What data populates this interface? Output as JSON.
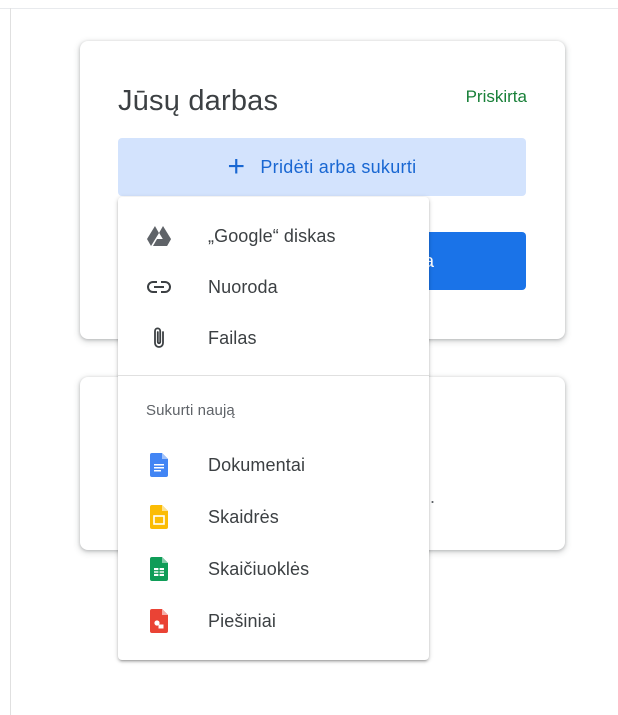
{
  "work_card": {
    "title": "Jūsų darbas",
    "status": "Priskirta",
    "add_button_icon": "+",
    "add_button_label": "Pridėti arba sukurti",
    "submit_button_fragment": "a",
    "submit_button_color": "#1a73e8"
  },
  "second_card": {
    "visible_fragment": "."
  },
  "menu": {
    "items": [
      {
        "label": "„Google“ diskas",
        "icon": "google-drive-icon"
      },
      {
        "label": "Nuoroda",
        "icon": "link-icon"
      },
      {
        "label": "Failas",
        "icon": "attachment-icon"
      }
    ],
    "create_section_label": "Sukurti naują",
    "create_items": [
      {
        "label": "Dokumentai",
        "icon": "google-docs-icon",
        "color": "#4285f4"
      },
      {
        "label": "Skaidrės",
        "icon": "google-slides-icon",
        "color": "#fbbc04"
      },
      {
        "label": "Skaičiuoklės",
        "icon": "google-sheets-icon",
        "color": "#0f9d58"
      },
      {
        "label": "Piešiniai",
        "icon": "google-drawings-icon",
        "color": "#ea4335"
      }
    ]
  },
  "colors": {
    "accent": "#1a73e8",
    "status_green": "#188038",
    "add_button_bg": "#d3e3fd"
  }
}
